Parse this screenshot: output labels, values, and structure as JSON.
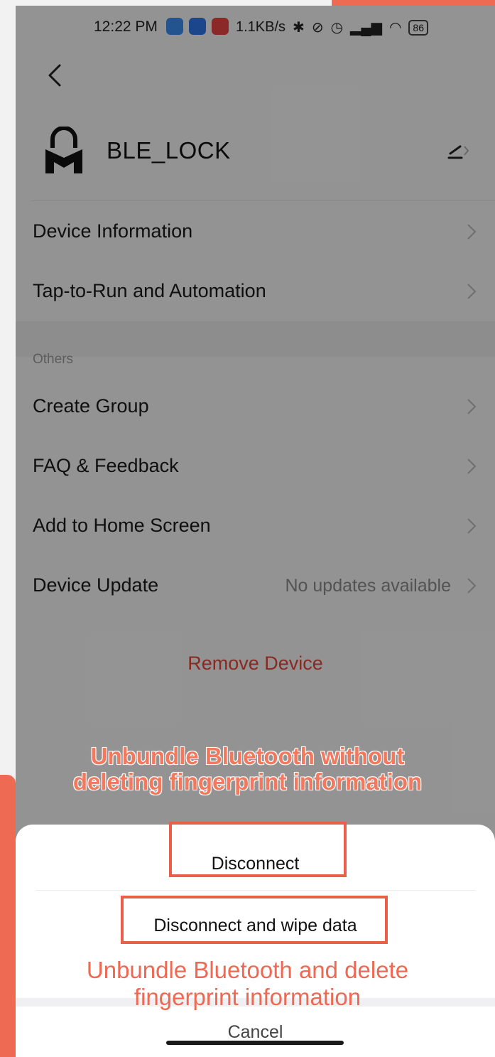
{
  "status_bar": {
    "time": "12:22 PM",
    "net_speed": "1.1KB/s",
    "battery": "86",
    "icons": [
      "bluetooth-icon",
      "mute-icon",
      "alarm-icon",
      "signal-icon",
      "wifi-icon",
      "battery-icon"
    ]
  },
  "device": {
    "name": "BLE_LOCK",
    "icon": "lock-icon"
  },
  "menu": {
    "items_top": [
      {
        "label": "Device Information"
      },
      {
        "label": "Tap-to-Run and Automation"
      }
    ],
    "section_label": "Others",
    "items_others": [
      {
        "label": "Create Group"
      },
      {
        "label": "FAQ & Feedback"
      },
      {
        "label": "Add to Home Screen"
      },
      {
        "label": "Device Update",
        "value": "No updates available"
      }
    ],
    "remove_label": "Remove Device"
  },
  "sheet": {
    "disconnect": "Disconnect",
    "disconnect_wipe": "Disconnect and wipe data",
    "cancel": "Cancel"
  },
  "annotations": {
    "top_note": "Unbundle Bluetooth without deleting fingerprint information",
    "top_line1": "Unbundle Bluetooth without",
    "top_line2": "deleting fingerprint information",
    "bottom_line1": "Unbundle Bluetooth and delete",
    "bottom_line2": "fingerprint information"
  },
  "colors": {
    "accent": "#ef6a52",
    "remove": "#e2463a",
    "overlay": "rgba(0,0,0,0.40)"
  }
}
